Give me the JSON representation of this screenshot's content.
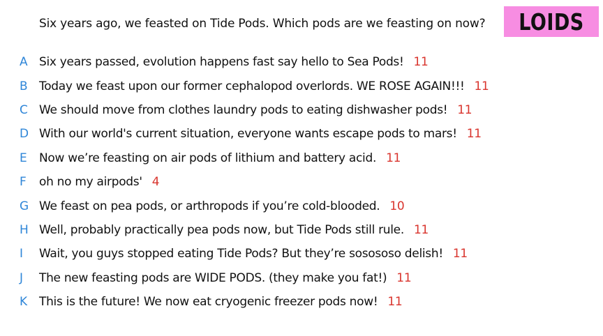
{
  "question": "Six years ago, we feasted on Tide Pods. Which pods are we feasting on now?",
  "logo": "LOIDS",
  "colors": {
    "logo_bg": "#f78de2",
    "letter": "#2f86d8",
    "score": "#d9352e"
  },
  "answers": [
    {
      "letter": "A",
      "text": "Six years passed, evolution happens fast say hello to Sea Pods!",
      "score": "11"
    },
    {
      "letter": "B",
      "text": "Today we feast upon our former cephalopod overlords. WE ROSE AGAIN!!!",
      "score": "11"
    },
    {
      "letter": "C",
      "text": "We should move from clothes laundry pods to eating dishwasher pods!",
      "score": "11"
    },
    {
      "letter": "D",
      "text": "With our world's current situation, everyone wants escape pods to mars!",
      "score": "11"
    },
    {
      "letter": "E",
      "text": "Now we’re feasting on air pods of lithium and battery acid.",
      "score": "11"
    },
    {
      "letter": "F",
      "text": "oh no my airpods'",
      "score": "4"
    },
    {
      "letter": "G",
      "text": "We feast on pea pods, or arthropods if you’re cold-blooded.",
      "score": "10"
    },
    {
      "letter": "H",
      "text": "Well, probably practically pea pods now, but Tide Pods still rule.",
      "score": "11"
    },
    {
      "letter": "I",
      "text": "Wait, you guys stopped eating Tide Pods? But they’re sosososo delish!",
      "score": "11"
    },
    {
      "letter": "J",
      "text": "The new feasting pods are WIDE PODS. (they make you fat!)",
      "score": "11"
    },
    {
      "letter": "K",
      "text": "This is the future! We now eat cryogenic freezer pods now!",
      "score": "11"
    }
  ]
}
